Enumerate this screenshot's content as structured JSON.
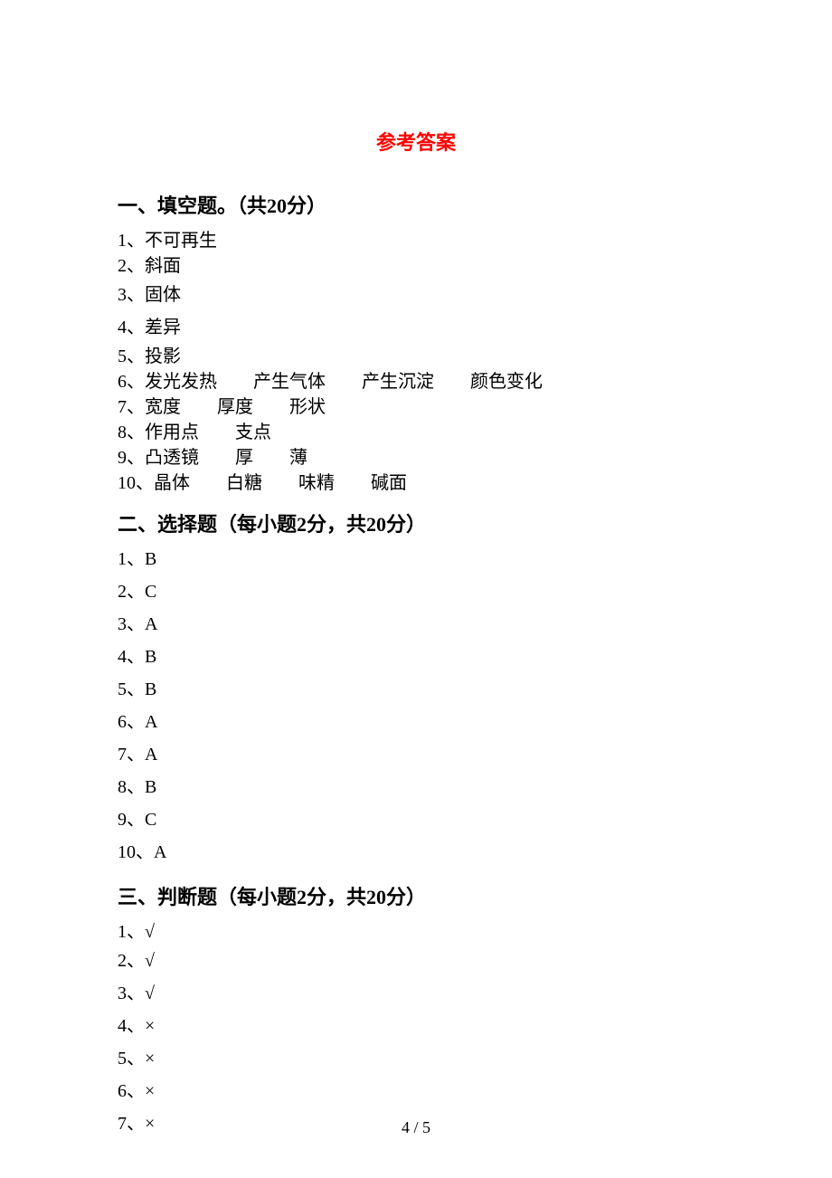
{
  "title": "参考答案",
  "sections": {
    "s1": {
      "heading": "一、填空题。（共20分）",
      "a1": "1、不可再生",
      "a2": "2、斜面",
      "a3": "3、固体",
      "a4": "4、差异",
      "a5": "5、投影",
      "a6": "6、发光发热　　产生气体　　产生沉淀　　颜色变化",
      "a7": "7、宽度　　厚度　　形状",
      "a8": "8、作用点　　支点",
      "a9": "9、凸透镜　　厚　　薄",
      "a10": "10、晶体　　白糖　　味精　　碱面"
    },
    "s2": {
      "heading": "二、选择题（每小题2分，共20分）",
      "a1": "1、B",
      "a2": "2、C",
      "a3": "3、A",
      "a4": "4、B",
      "a5": "5、B",
      "a6": "6、A",
      "a7": "7、A",
      "a8": "8、B",
      "a9": "9、C",
      "a10": "10、A"
    },
    "s3": {
      "heading": "三、判断题（每小题2分，共20分）",
      "a1": "1、√",
      "a2": "2、√",
      "a3": "3、√",
      "a4": "4、×",
      "a5": "5、×",
      "a6": "6、×",
      "a7": "7、×"
    }
  },
  "page_number": "4 / 5"
}
